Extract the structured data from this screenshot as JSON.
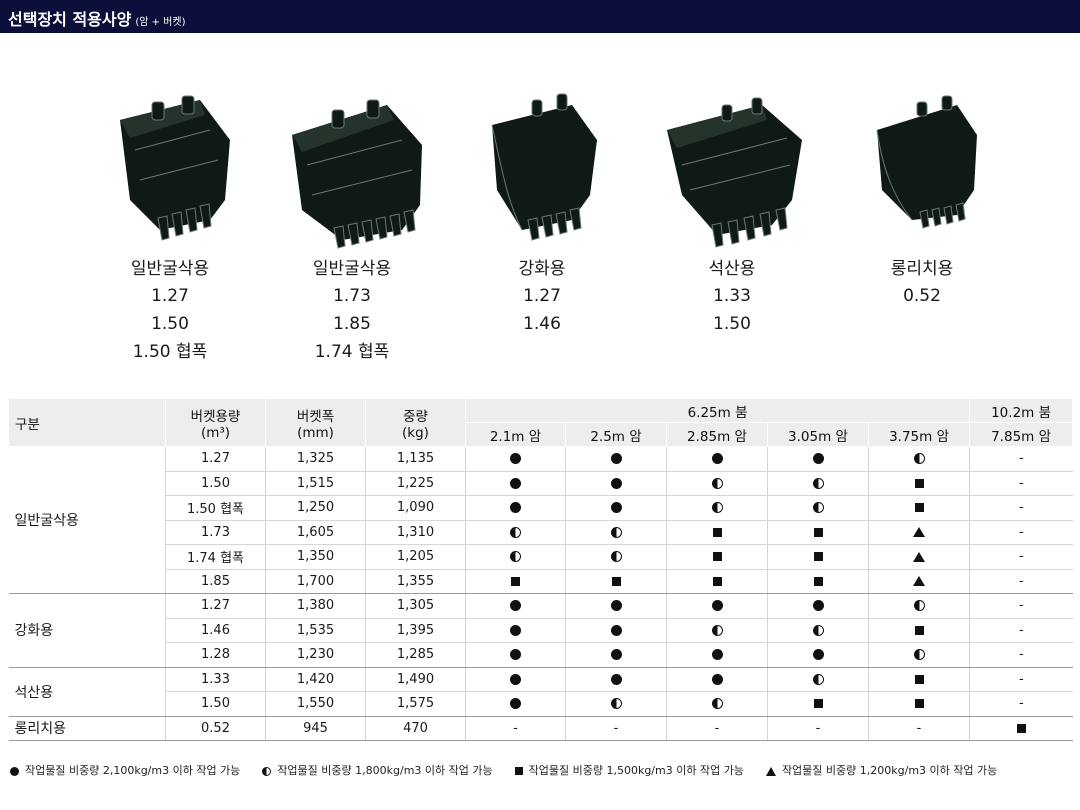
{
  "header": {
    "title": "선택장치 적용사양",
    "subtitle": "(암 + 버켓)"
  },
  "colors": {
    "header_bg": "#0c0f3a",
    "bucket_fill": "#0f1a14"
  },
  "buckets": [
    {
      "icon": "bucket-general-icon",
      "name": "일반굴삭용",
      "values": [
        "1.27",
        "1.50",
        "1.50 협폭"
      ]
    },
    {
      "icon": "bucket-general-large-icon",
      "name": "일반굴삭용",
      "values": [
        "1.73",
        "1.85",
        "1.74 협폭"
      ]
    },
    {
      "icon": "bucket-heavy-duty-icon",
      "name": "강화용",
      "values": [
        "1.27",
        "1.46"
      ]
    },
    {
      "icon": "bucket-rock-icon",
      "name": "석산용",
      "values": [
        "1.33",
        "1.50"
      ]
    },
    {
      "icon": "bucket-slope-icon",
      "name": "롱리치용",
      "values": [
        "0.52"
      ]
    }
  ],
  "table": {
    "headers": {
      "category": "구분",
      "capacity": "버켓용량",
      "capacity_unit": "(m³)",
      "width": "버켓폭",
      "width_unit": "(mm)",
      "weight": "중량",
      "weight_unit": "(kg)",
      "boom_std": "6.25m 붐",
      "boom_long": "10.2m 붐",
      "arms": [
        "2.1m 암",
        "2.5m 암",
        "2.85m 암",
        "3.05m 암",
        "3.75m 암",
        "7.85m 암"
      ]
    },
    "groups": [
      {
        "name": "일반굴삭용",
        "rows": [
          {
            "capacity": "1.27",
            "width": "1,325",
            "weight": "1,135",
            "marks": [
              "full",
              "full",
              "full",
              "full",
              "half",
              "dash"
            ]
          },
          {
            "capacity": "1.50",
            "width": "1,515",
            "weight": "1,225",
            "marks": [
              "full",
              "full",
              "half",
              "half",
              "square",
              "dash"
            ]
          },
          {
            "capacity": "1.50 협폭",
            "width": "1,250",
            "weight": "1,090",
            "marks": [
              "full",
              "full",
              "half",
              "half",
              "square",
              "dash"
            ]
          },
          {
            "capacity": "1.73",
            "width": "1,605",
            "weight": "1,310",
            "marks": [
              "half",
              "half",
              "square",
              "square",
              "tri",
              "dash"
            ]
          },
          {
            "capacity": "1.74 협폭",
            "width": "1,350",
            "weight": "1,205",
            "marks": [
              "half",
              "half",
              "square",
              "square",
              "tri",
              "dash"
            ]
          },
          {
            "capacity": "1.85",
            "width": "1,700",
            "weight": "1,355",
            "marks": [
              "square",
              "square",
              "square",
              "square",
              "tri",
              "dash"
            ]
          }
        ]
      },
      {
        "name": "강화용",
        "rows": [
          {
            "capacity": "1.27",
            "width": "1,380",
            "weight": "1,305",
            "marks": [
              "full",
              "full",
              "full",
              "full",
              "half",
              "dash"
            ]
          },
          {
            "capacity": "1.46",
            "width": "1,535",
            "weight": "1,395",
            "marks": [
              "full",
              "full",
              "half",
              "half",
              "square",
              "dash"
            ]
          },
          {
            "capacity": "1.28",
            "width": "1,230",
            "weight": "1,285",
            "marks": [
              "full",
              "full",
              "full",
              "full",
              "half",
              "dash"
            ]
          }
        ]
      },
      {
        "name": "석산용",
        "rows": [
          {
            "capacity": "1.33",
            "width": "1,420",
            "weight": "1,490",
            "marks": [
              "full",
              "full",
              "full",
              "half",
              "square",
              "dash"
            ]
          },
          {
            "capacity": "1.50",
            "width": "1,550",
            "weight": "1,575",
            "marks": [
              "full",
              "half",
              "half",
              "square",
              "square",
              "dash"
            ]
          }
        ]
      },
      {
        "name": "롱리치용",
        "rows": [
          {
            "capacity": "0.52",
            "width": "945",
            "weight": "470",
            "marks": [
              "dash",
              "dash",
              "dash",
              "dash",
              "dash",
              "square"
            ]
          }
        ]
      }
    ]
  },
  "legend": [
    {
      "symbol": "full",
      "text": "작업물질 비중량 2,100kg/m3 이하 작업 가능"
    },
    {
      "symbol": "half",
      "text": "작업물질 비중량 1,800kg/m3 이하 작업 가능"
    },
    {
      "symbol": "square",
      "text": "작업물질 비중량 1,500kg/m3 이하 작업 가능"
    },
    {
      "symbol": "tri",
      "text": "작업물질 비중량 1,200kg/m3 이하 작업 가능"
    }
  ],
  "dash_text": "-"
}
